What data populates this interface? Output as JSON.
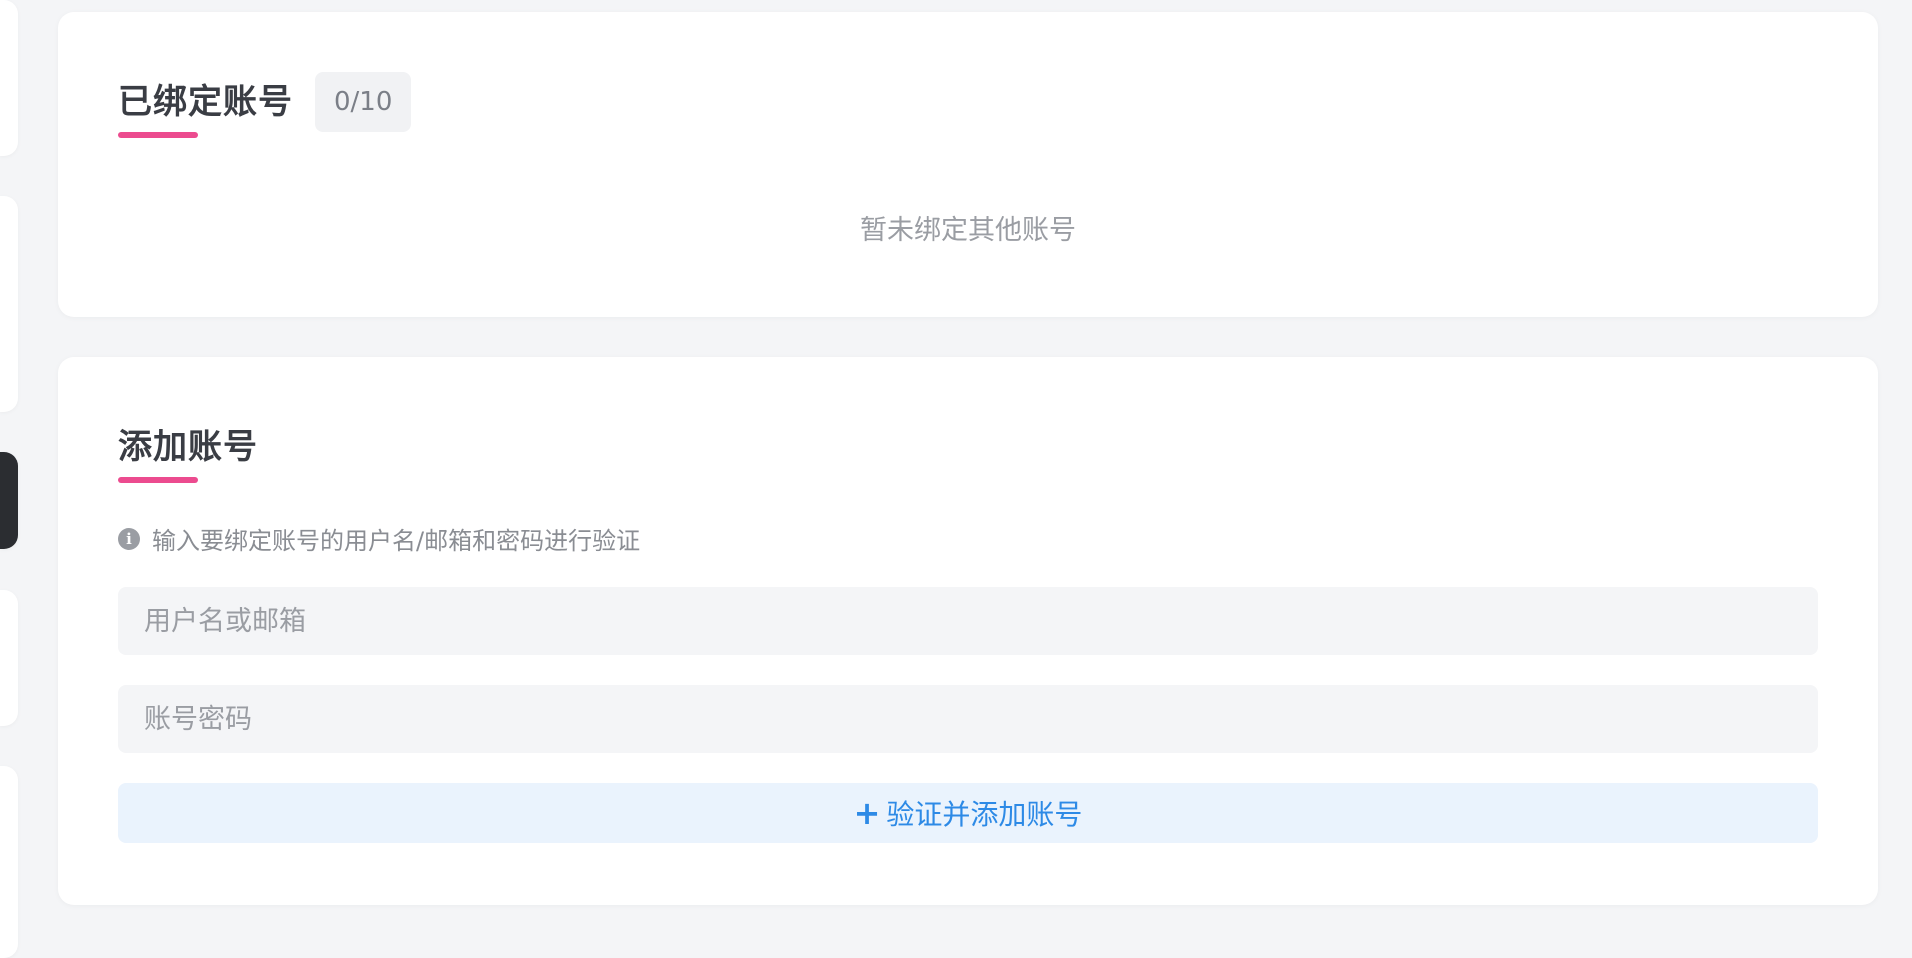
{
  "bound_section": {
    "title": "已绑定账号",
    "count": "0/10",
    "empty_message": "暂未绑定其他账号"
  },
  "add_section": {
    "title": "添加账号",
    "hint": "输入要绑定账号的用户名/邮箱和密码进行验证",
    "username_placeholder": "用户名或邮箱",
    "password_placeholder": "账号密码",
    "submit_label": "验证并添加账号",
    "submit_icon": "+"
  },
  "colors": {
    "accent_pink": "#ec4b8f",
    "button_text_blue": "#2d8ae6",
    "button_bg": "#eaf3fd"
  }
}
